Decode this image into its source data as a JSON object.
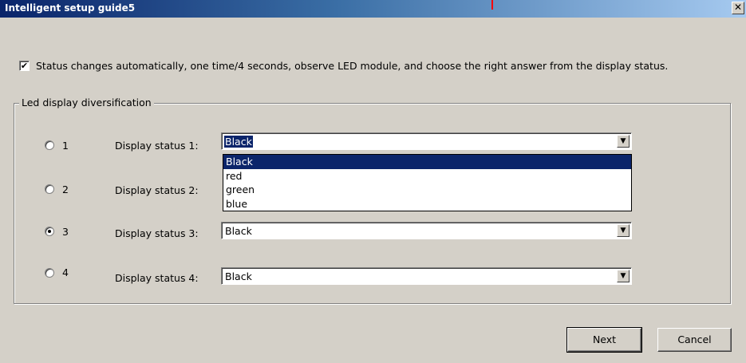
{
  "window": {
    "title": "Intelligent setup guide5",
    "close_label": "✕"
  },
  "auto_checkbox": {
    "checked": true,
    "check_mark": "✔",
    "label": "Status changes automatically, one time/4 seconds, observe LED module, and choose the right answer from the display status."
  },
  "group": {
    "title": "Led display diversification",
    "rows": [
      {
        "radio_label": "1",
        "status_label": "Display status 1:",
        "value": "Black",
        "selected": false
      },
      {
        "radio_label": "2",
        "status_label": "Display status 2:",
        "value": "",
        "selected": false
      },
      {
        "radio_label": "3",
        "status_label": "Display status 3:",
        "value": "Black",
        "selected": true
      },
      {
        "radio_label": "4",
        "status_label": "Display status 4:",
        "value": "Black",
        "selected": false
      }
    ]
  },
  "dropdown": {
    "options": [
      "Black",
      "red",
      "green",
      "blue"
    ],
    "highlighted": "Black"
  },
  "buttons": {
    "next": "Next",
    "cancel": "Cancel"
  },
  "colors": {
    "titlebar_start": "#0a246a",
    "titlebar_end": "#a6caf0",
    "face": "#d4d0c8",
    "selection": "#0a246a",
    "marker": "#ff0000"
  }
}
